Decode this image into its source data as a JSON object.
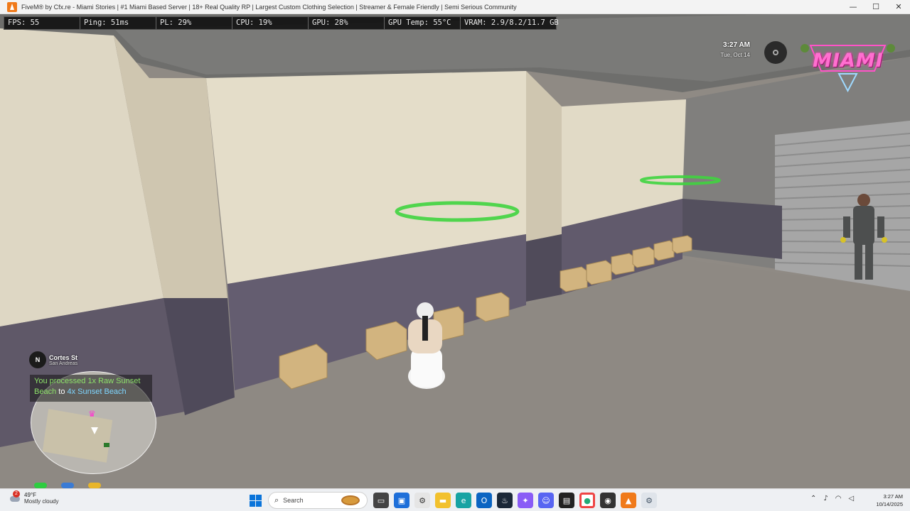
{
  "window": {
    "title": "FiveM® by Cfx.re - Miami Stories | #1 Miami Based Server | 18+ Real Quality RP | Largest Custom Clothing Selection | Streamer & Female Friendly | Semi Serious Community",
    "minimize": "—",
    "maximize": "☐",
    "close": "✕"
  },
  "perf": {
    "fps": "FPS: 55",
    "ping": "Ping: 51ms",
    "pl": "PL: 29%",
    "cpu": "CPU: 19%",
    "gpu": "GPU: 28%",
    "gpu_temp": "GPU Temp: 55°C",
    "vram": "VRAM: 2.9/8.2/11.7 GB"
  },
  "hud": {
    "time": "3:27 AM",
    "date": "Tue, Oct 14",
    "logo_text": "MIAMI",
    "compass": "N",
    "street": "Cortes St",
    "area": "San Andreas",
    "notification": {
      "prefix": "You processed ",
      "item1": "1x Raw Sunset Beach",
      "middle": " to ",
      "item2": "4x Sunset Beach"
    }
  },
  "taskbar": {
    "weather_temp": "49°F",
    "weather_cond": "Mostly cloudy",
    "weather_badge": "2",
    "search_label": "Search",
    "clock_time": "3:27 AM",
    "clock_date": "10/14/2025",
    "colors": {
      "accent": "#0a74da"
    }
  }
}
